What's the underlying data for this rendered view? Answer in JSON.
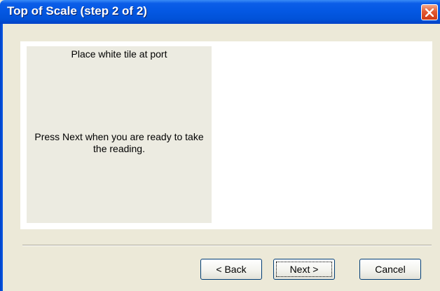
{
  "window": {
    "title": "Top of Scale (step 2 of 2)",
    "close_icon": "close-icon"
  },
  "instructions": {
    "line_top": "Place white tile at port",
    "line_middle": "Press Next when you are ready to take the reading."
  },
  "buttons": {
    "back": "< Back",
    "next": "Next >",
    "cancel": "Cancel"
  },
  "colors": {
    "titlebar": "#0458e3",
    "close_button": "#e35b33",
    "dialog_face": "#ece9d8"
  }
}
